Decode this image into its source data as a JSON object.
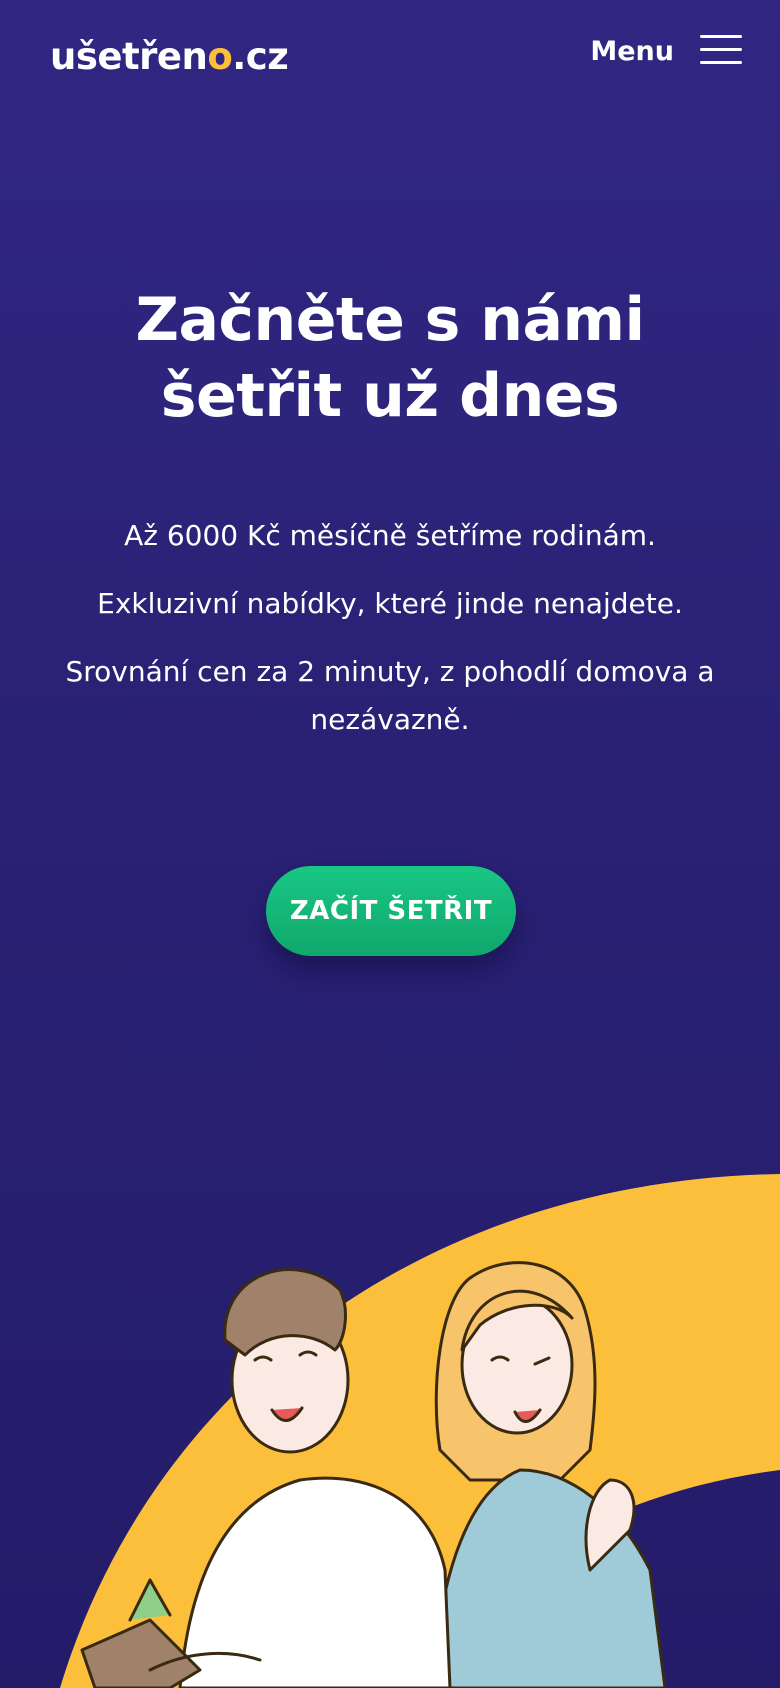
{
  "header": {
    "logo_main": "ušetřen",
    "logo_accent": "o",
    "logo_suffix": ".cz",
    "menu_label": "Menu"
  },
  "hero": {
    "title": "Začněte s námi šetřit už dnes",
    "lines": [
      "Až 6000 Kč měsíčně šetříme rodinám.",
      "Exkluzivní nabídky, které jinde nenajdete.",
      "Srovnání cen za 2 minuty, z pohodlí domova a nezávazně."
    ],
    "cta_label": "ZAČÍT ŠETŘIT"
  },
  "colors": {
    "background": "#2f2680",
    "accent_yellow": "#fbbf3c",
    "cta_green": "#16b877"
  },
  "icons": {
    "menu": "hamburger-menu-icon"
  }
}
